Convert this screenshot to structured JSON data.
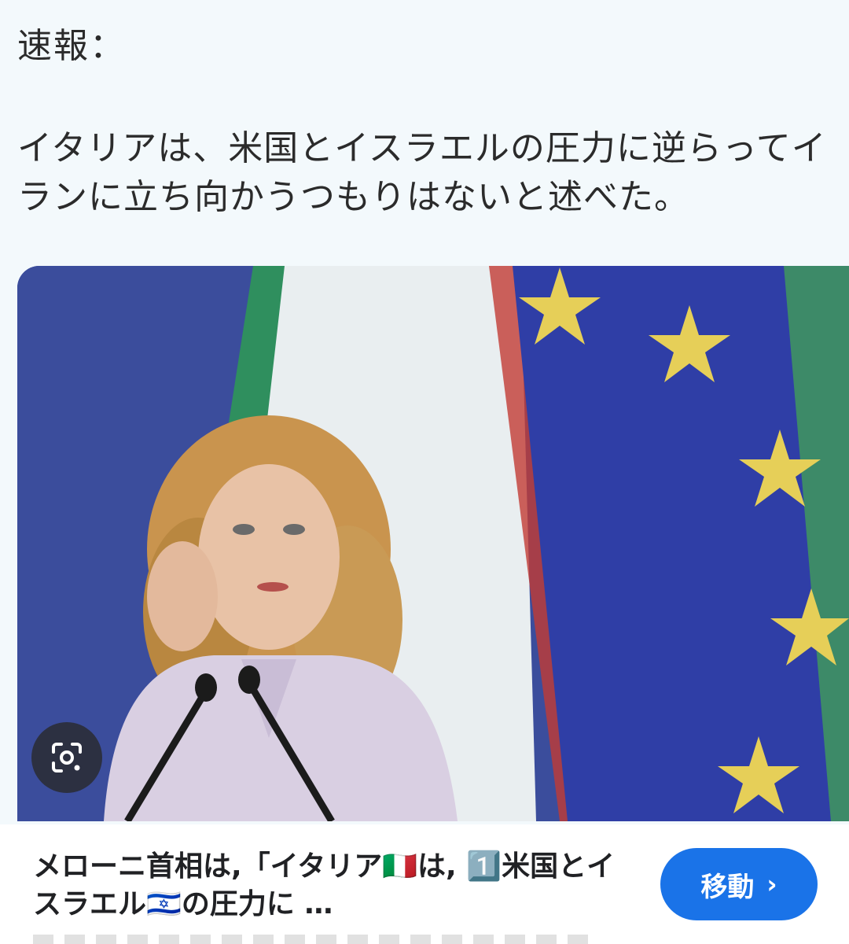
{
  "post": {
    "label": "速報：",
    "body": "イタリアは、米国とイスラエルの圧力に逆らってイランに立ち向かうつもりはないと述べた。"
  },
  "image": {
    "description_icon": "photo-of-speaker-with-flags"
  },
  "lens": {
    "icon": "camera-search-icon"
  },
  "result": {
    "title": "メローニ首相は,「イタリア🇮🇹は, 1️⃣米国とイスラエル🇮🇱の圧力に …",
    "visit_label": "移動",
    "visit_chevron": "›"
  },
  "colors": {
    "accent": "#1a73e8",
    "post_bg": "#f3f9fc",
    "eu_blue": "#2f3ea6",
    "italy_green": "#2f8f5e"
  }
}
